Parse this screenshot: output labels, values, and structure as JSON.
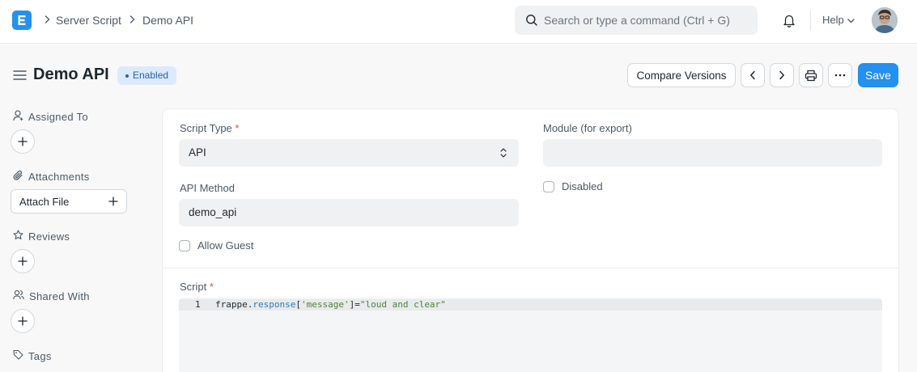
{
  "navbar": {
    "logo_letter": "E",
    "breadcrumbs": [
      "Server Script",
      "Demo API"
    ],
    "search_placeholder": "Search or type a command (Ctrl + G)",
    "help_label": "Help"
  },
  "page": {
    "title": "Demo API",
    "status": "Enabled"
  },
  "toolbar": {
    "compare_label": "Compare Versions",
    "save_label": "Save"
  },
  "sidebar": {
    "assigned_to": "Assigned To",
    "attachments": "Attachments",
    "attach_file": "Attach File",
    "reviews": "Reviews",
    "shared_with": "Shared With",
    "tags": "Tags"
  },
  "form": {
    "script_type_label": "Script Type",
    "script_type_value": "API",
    "module_label": "Module (for export)",
    "module_value": "",
    "api_method_label": "API Method",
    "api_method_value": "demo_api",
    "disabled_label": "Disabled",
    "allow_guest_label": "Allow Guest",
    "script_label": "Script",
    "required_mark": "*"
  },
  "code": {
    "line_number": "1",
    "tokens": {
      "obj": "frappe",
      "dot": ".",
      "prop": "response",
      "open": "[",
      "key": "'message'",
      "close": "]",
      "eq": "=",
      "str": "\"loud and clear\""
    }
  },
  "colors": {
    "primary": "#2490ef",
    "badge_bg": "#dbeafe",
    "badge_text": "#2d5ea8",
    "required": "#e24c4c",
    "code_prop": "#2a7ab8",
    "code_string": "#50823a"
  }
}
